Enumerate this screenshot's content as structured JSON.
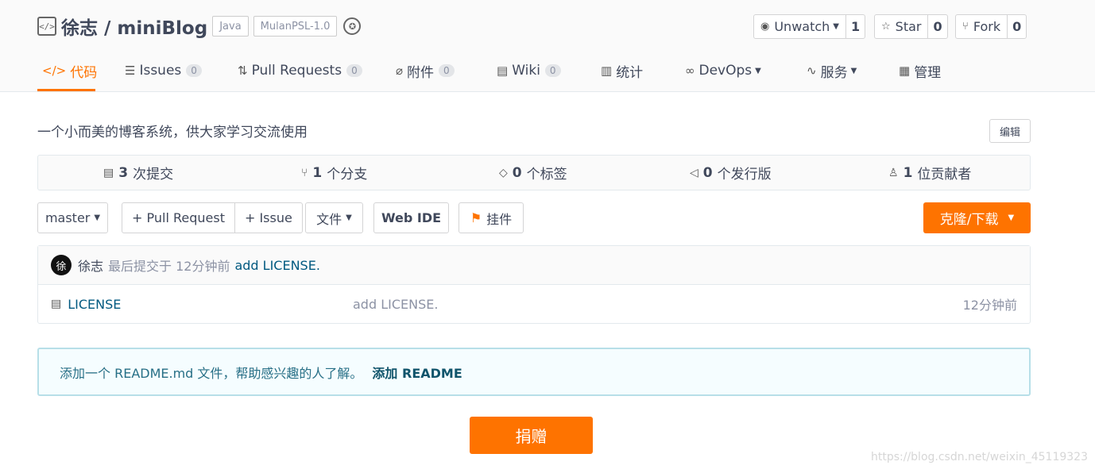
{
  "repo": {
    "name": "徐志 / miniBlog",
    "tags": [
      "Java",
      "MulanPSL-1.0"
    ],
    "description": "一个小而美的博客系统，供大家学习交流使用",
    "edit_label": "编辑"
  },
  "actions": {
    "watch_label": "Unwatch",
    "watch_count": "1",
    "star_label": "Star",
    "star_count": "0",
    "fork_label": "Fork",
    "fork_count": "0"
  },
  "nav": {
    "code": "代码",
    "issues": "Issues",
    "issues_count": "0",
    "pulls": "Pull Requests",
    "pulls_count": "0",
    "attachments": "附件",
    "attachments_count": "0",
    "wiki": "Wiki",
    "wiki_count": "0",
    "stats": "统计",
    "devops": "DevOps",
    "services": "服务",
    "manage": "管理"
  },
  "stats": {
    "commits_num": "3",
    "commits_label": "次提交",
    "branches_num": "1",
    "branches_label": "个分支",
    "tags_num": "0",
    "tags_label": "个标签",
    "releases_num": "0",
    "releases_label": "个发行版",
    "contributors_num": "1",
    "contributors_label": "位贡献者"
  },
  "toolbar": {
    "branch": "master",
    "pull_request": "+ Pull Request",
    "issue": "+ Issue",
    "files": "文件",
    "web_ide": "Web IDE",
    "pendant": "挂件",
    "clone": "克隆/下载"
  },
  "last_commit": {
    "avatar_text": "徐",
    "author": "徐志",
    "meta": "最后提交于 12分钟前",
    "message": "add LICENSE."
  },
  "files": [
    {
      "name": "LICENSE",
      "message": "add LICENSE.",
      "time": "12分钟前"
    }
  ],
  "readme_notice": {
    "text": "添加一个 README.md 文件，帮助感兴趣的人了解。",
    "link": "添加 README"
  },
  "donate_label": "捐赠",
  "watermark": "https://blog.csdn.net/weixin_45119323"
}
